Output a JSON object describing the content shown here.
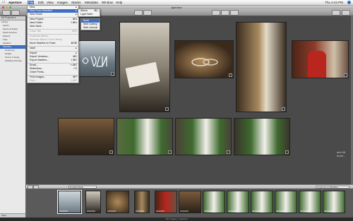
{
  "menubar": {
    "apple": "",
    "items": [
      "Aperture",
      "File",
      "Edit",
      "View",
      "Images",
      "Stacks",
      "Metadata",
      "Window",
      "Help"
    ],
    "clock": "Thu 4:43 PM"
  },
  "window": {
    "title": "Aperture"
  },
  "projects": {
    "header": "All Projects ▾",
    "rows": [
      "Library",
      "Sports",
      "Sports Activities",
      "South America",
      "Flowers",
      "Trips",
      "Vacation",
      "Wedding",
      "Ceremony",
      "Details",
      "Groom & Gang",
      "Wedding Portraits"
    ],
    "selected_index": 7,
    "bottom": "Vault"
  },
  "file_menu": [
    {
      "label": "New",
      "shortcut": "",
      "arrow": "▸",
      "state": ""
    },
    {
      "label": "New From Selection",
      "shortcut": "",
      "arrow": "▸",
      "state": "hl"
    },
    {
      "label": "New Smart",
      "shortcut": "",
      "arrow": "▸",
      "state": ""
    },
    {
      "sep": true
    },
    {
      "label": "New Project",
      "shortcut": "⌘N",
      "arrow": "",
      "state": ""
    },
    {
      "label": "New Folder",
      "shortcut": "⇧⌘N",
      "arrow": "",
      "state": ""
    },
    {
      "label": "New Vault...",
      "shortcut": "",
      "arrow": "",
      "state": ""
    },
    {
      "sep": true
    },
    {
      "label": "Close Tab",
      "shortcut": "⌘W",
      "arrow": "",
      "state": "dis"
    },
    {
      "sep": true
    },
    {
      "label": "Duplicate Album",
      "shortcut": "",
      "arrow": "",
      "state": "dis"
    },
    {
      "label": "Remove Album From Library",
      "shortcut": "",
      "arrow": "",
      "state": "dis"
    },
    {
      "label": "Move Masters to Trash",
      "shortcut": "⌘⌫",
      "arrow": "",
      "state": ""
    },
    {
      "sep": true
    },
    {
      "label": "Vault",
      "shortcut": "",
      "arrow": "▸",
      "state": ""
    },
    {
      "sep": true
    },
    {
      "label": "Import",
      "shortcut": "",
      "arrow": "▸",
      "state": ""
    },
    {
      "label": "Export Versions...",
      "shortcut": "⌘E",
      "arrow": "",
      "state": ""
    },
    {
      "label": "Export Masters...",
      "shortcut": "⇧⌘E",
      "arrow": "",
      "state": ""
    },
    {
      "sep": true
    },
    {
      "label": "Email...",
      "shortcut": "⌥⌘E",
      "arrow": "",
      "state": ""
    },
    {
      "label": "Slideshow...",
      "shortcut": "⇧S",
      "arrow": "",
      "state": ""
    },
    {
      "label": "Order Prints...",
      "shortcut": "",
      "arrow": "",
      "state": ""
    },
    {
      "sep": true
    },
    {
      "label": "Print Images...",
      "shortcut": "⌘P",
      "arrow": "",
      "state": ""
    },
    {
      "label": "Print...",
      "shortcut": "⇧⌘P",
      "arrow": "",
      "state": "dis"
    }
  ],
  "submenu1": [
    {
      "label": "Album",
      "shortcut": "⌘L"
    },
    {
      "label": "Light Table",
      "shortcut": ""
    }
  ],
  "submenu2": [
    {
      "label": "Book",
      "state": "hl"
    },
    {
      "label": "Web Gallery",
      "state": ""
    },
    {
      "label": "Web Journal",
      "state": ""
    }
  ],
  "viewer": {
    "more_label": "and 48 more..."
  },
  "midbar": {
    "left_field": "Unrated Stack",
    "right_field": "Ceremony in Wedding"
  },
  "status": "187 images, 1 selected",
  "colors": {
    "accent": "#3d6fc4",
    "viewer_bg": "#4a4a4a"
  }
}
